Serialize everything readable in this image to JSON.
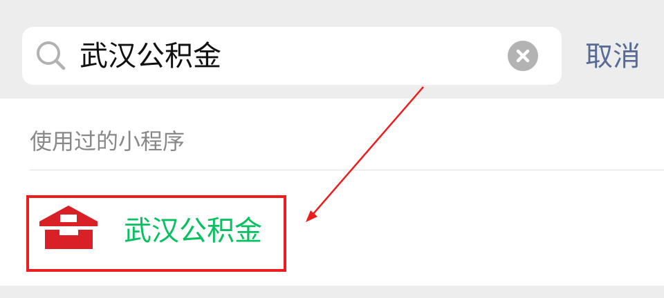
{
  "search": {
    "query": "武汉公积金",
    "cancel_label": "取消"
  },
  "section": {
    "title": "使用过的小程序"
  },
  "results": [
    {
      "name": "武汉公积金",
      "icon": "house-logo-icon"
    }
  ],
  "colors": {
    "background_gray": "#ededed",
    "cancel_link": "#576b95",
    "result_name": "#07c160",
    "logo_red": "#d92027",
    "annotation_red": "#ee1c1c"
  },
  "icons": {
    "search": "search-icon",
    "clear": "clear-icon",
    "logo": "house-logo-icon",
    "arrow": "annotation-arrow"
  }
}
